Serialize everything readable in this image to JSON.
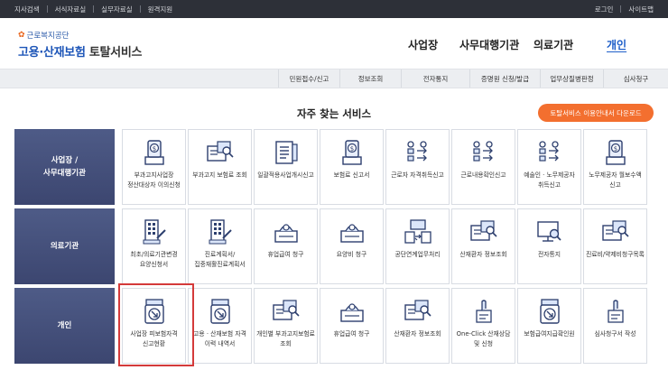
{
  "topbar": {
    "left_links": [
      "지사검색",
      "서식자료실",
      "실무자료실",
      "원격지원"
    ],
    "right_links": [
      "로그인",
      "사이트맵"
    ]
  },
  "logo": {
    "subtitle": "근로복지공단",
    "title_part1": "고용·산재보험",
    "title_part2": "토탈서비스"
  },
  "gnb": [
    "사업장",
    "사무대행기관",
    "의료기관",
    "개인"
  ],
  "submenu": [
    "민원접수/신고",
    "정보조회",
    "전자통지",
    "증명원 신청/발급",
    "업무상질병판정",
    "심사청구"
  ],
  "section": {
    "title": "자주 찾는 서비스",
    "download_button": "토탈서비스 이용안내서 다운로드"
  },
  "rows": [
    {
      "label": "사업장 /\n사무대행기관",
      "items": [
        {
          "icon": "money-bag-icon",
          "label": "부과고지사업장 정산대상자 이의신청"
        },
        {
          "icon": "card-search-icon",
          "label": "부과고지 보험료 조회"
        },
        {
          "icon": "document-list-icon",
          "label": "일괄적용사업개시신고"
        },
        {
          "icon": "money-bag-icon",
          "label": "보험료 신고서"
        },
        {
          "icon": "people-transfer-icon",
          "label": "근로자 자격취득신고"
        },
        {
          "icon": "people-transfer-icon",
          "label": "근로내용확인신고"
        },
        {
          "icon": "people-transfer-icon",
          "label": "예술인 · 노무제공자 취득신고"
        },
        {
          "icon": "money-bag-icon",
          "label": "노무제공자 월보수액 신고"
        }
      ]
    },
    {
      "label": "의료기관",
      "items": [
        {
          "icon": "calculator-doc-icon",
          "label": "최초/의료기관변경 요양신청서"
        },
        {
          "icon": "calculator-doc-icon",
          "label": "진료계획서/집중재활진료계획서"
        },
        {
          "icon": "cash-box-icon",
          "label": "휴업급여 청구"
        },
        {
          "icon": "cash-box-icon",
          "label": "요양비 청구"
        },
        {
          "icon": "exchange-doc-icon",
          "label": "공단연계업무처리"
        },
        {
          "icon": "card-search-icon",
          "label": "산재환자 정보조회"
        },
        {
          "icon": "monitor-search-icon",
          "label": "전자통지"
        },
        {
          "icon": "card-search-icon",
          "label": "진료비/약제비청구목록"
        }
      ]
    },
    {
      "label": "개인",
      "items": [
        {
          "icon": "download-doc-icon",
          "label": "사업장 피보험자격 신고현황"
        },
        {
          "icon": "download-doc-icon",
          "label": "고용 · 산재보험 자격 이력 내역서"
        },
        {
          "icon": "card-search-icon",
          "label": "개인별 부과고지보험료 조회"
        },
        {
          "icon": "cash-box-icon",
          "label": "휴업급여 청구"
        },
        {
          "icon": "card-search-icon",
          "label": "산재환자 정보조회"
        },
        {
          "icon": "touch-doc-icon",
          "label": "One-Click 산재상담 및 신청"
        },
        {
          "icon": "download-doc-icon",
          "label": "보험급여지급확인원"
        },
        {
          "icon": "touch-doc-icon",
          "label": "심사청구서 작성"
        }
      ]
    }
  ],
  "highlighted_item": "사업장 피보험자격 신고현황"
}
